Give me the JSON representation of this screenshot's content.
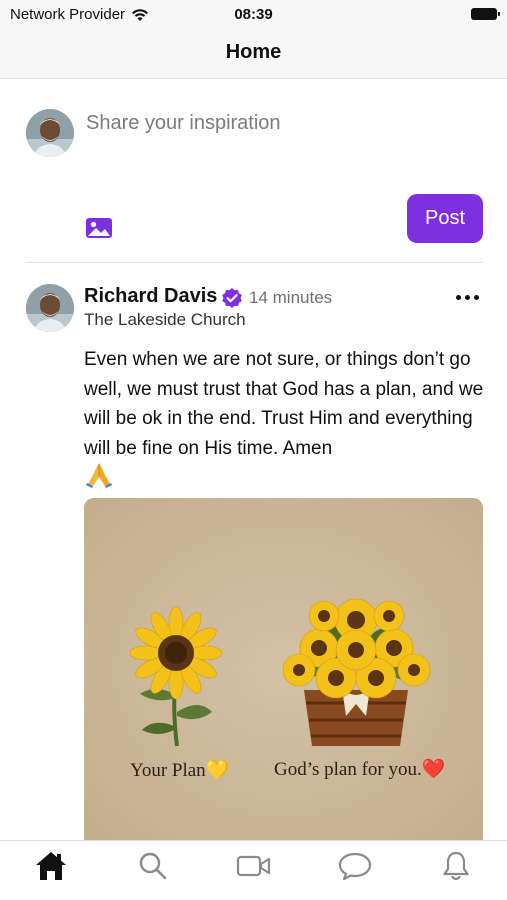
{
  "status_bar": {
    "carrier": "Network Provider",
    "time": "08:39"
  },
  "header": {
    "title": "Home"
  },
  "composer": {
    "placeholder": "Share your inspiration",
    "post_label": "Post"
  },
  "post": {
    "author": "Richard Davis",
    "time_ago": "14 minutes",
    "church": "The Lakeside Church",
    "body": "Even when we are not sure, or things don’t go well, we must trust that God has a plan, and we will be ok in the end. Trust Him and everything will be fine on His time. Amen",
    "image": {
      "left_caption": "Your Plan💛",
      "right_caption": "God’s plan for you.❤️"
    }
  },
  "tabs": [
    {
      "name": "home-icon",
      "active": true
    },
    {
      "name": "search-icon",
      "active": false
    },
    {
      "name": "video-icon",
      "active": false
    },
    {
      "name": "chat-icon",
      "active": false
    },
    {
      "name": "bell-icon",
      "active": false
    }
  ],
  "colors": {
    "accent": "#7e2fe0",
    "background": "#ffffff",
    "header_bg": "#f7f7f7"
  }
}
